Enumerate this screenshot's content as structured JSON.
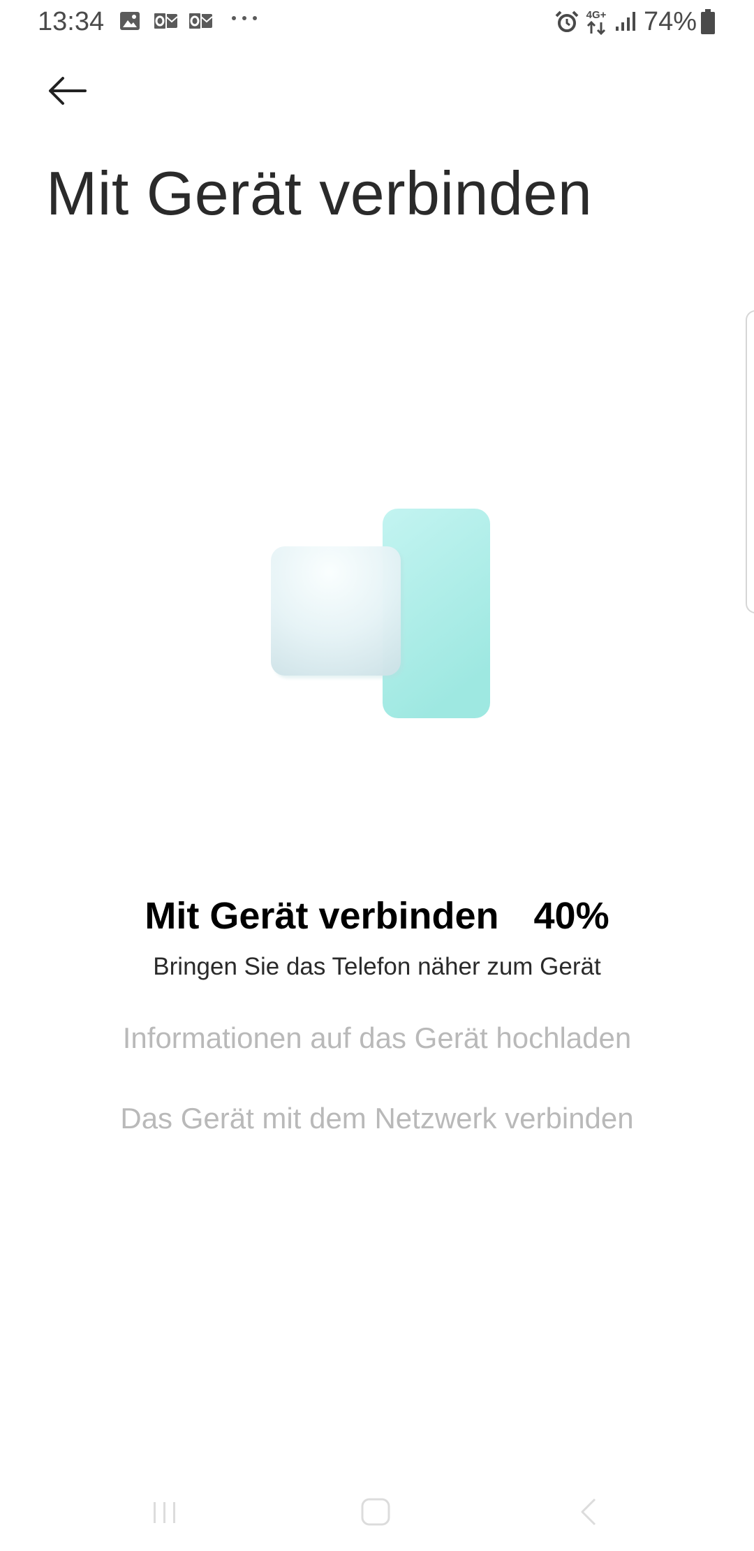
{
  "status_bar": {
    "time": "13:34",
    "network_type": "4G+",
    "battery_percent": "74%",
    "more_indicator": "···",
    "icons": [
      "image-icon",
      "outlook-icon",
      "outlook-icon",
      "more-icon",
      "alarm-icon",
      "4g-data-icon",
      "signal-icon",
      "battery-icon"
    ]
  },
  "header": {
    "back_icon": "arrow-left-icon",
    "title": "Mit Gerät verbinden"
  },
  "illustration": {
    "icon": "phone-device-connect-illustration",
    "colors": {
      "front_card": "#e3f1f4",
      "back_card": "#a6ece6"
    }
  },
  "progress": {
    "label": "Mit Gerät verbinden",
    "percent_text": "40%",
    "value": 0.4,
    "hint": "Bringen Sie das Telefon näher zum Gerät"
  },
  "steps": [
    {
      "label": "Informationen auf das Gerät hochladen",
      "state": "pending"
    },
    {
      "label": "Das Gerät mit dem Netzwerk verbinden",
      "state": "pending"
    }
  ],
  "nav_bar": {
    "icons": [
      "recent-apps-icon",
      "home-icon",
      "back-icon"
    ]
  },
  "colors": {
    "text_primary": "#2a2a2a",
    "text_disabled": "#b9b9b9",
    "accent": "#a6ece6"
  }
}
